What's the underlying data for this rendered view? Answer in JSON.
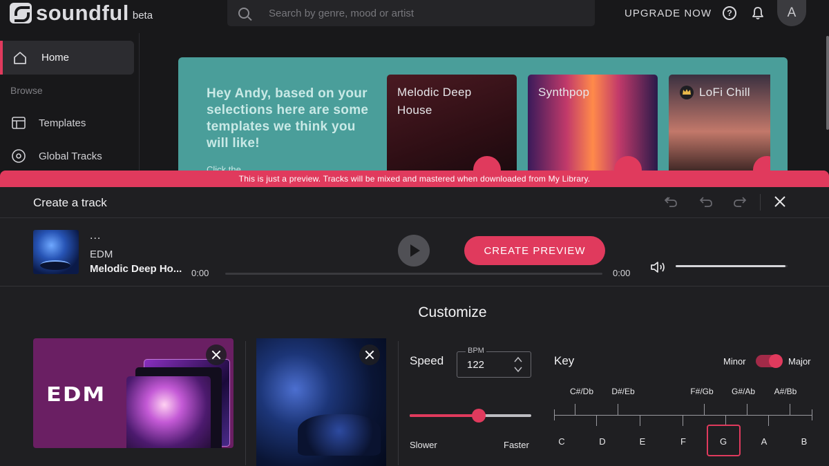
{
  "app": {
    "logo_text": "soundful",
    "logo_badge": "beta"
  },
  "header": {
    "search_placeholder": "Search by genre, mood or artist",
    "upgrade_label": "UPGRADE NOW",
    "help_glyph": "?",
    "avatar_initial": "A",
    "icons": [
      "search-icon",
      "help-icon",
      "bell-icon"
    ]
  },
  "sidebar": {
    "home_label": "Home",
    "browse_label": "Browse",
    "items": [
      {
        "label": "Templates",
        "icon": "templates-icon"
      },
      {
        "label": "Global Tracks",
        "icon": "global-tracks-icon"
      }
    ]
  },
  "banner": {
    "headline": "Hey Andy, based on your selections here are some templates we think you will like!",
    "sub_text": "Click the",
    "cards": [
      {
        "title": "Melodic Deep House",
        "premium": false
      },
      {
        "title": "Synthpop",
        "premium": false
      },
      {
        "title": "LoFi Chill",
        "premium": true
      }
    ]
  },
  "notice": "This is just a preview. Tracks will be mixed and mastered when downloaded from My Library.",
  "panel": {
    "title": "Create a track",
    "toolbar_icons": [
      "history-icon",
      "undo-icon",
      "redo-icon",
      "close-icon"
    ]
  },
  "player": {
    "track_title": "...",
    "genre": "EDM",
    "template_name": "Melodic Deep Ho...",
    "time_elapsed": "0:00",
    "time_total": "0:00",
    "progress": 0,
    "create_label": "CREATE PREVIEW",
    "volume": 0.98
  },
  "customize": {
    "heading": "Customize",
    "genre_card_label": "EDM",
    "speed": {
      "label": "Speed",
      "bpm_caption": "BPM",
      "bpm_value": "122",
      "slider_value": 0.57,
      "slower_label": "Slower",
      "faster_label": "Faster"
    },
    "key": {
      "label": "Key",
      "minor_label": "Minor",
      "major_label": "Major",
      "mode": "Major",
      "sharps": [
        "C#/Db",
        "D#/Eb",
        "F#/Gb",
        "G#/Ab",
        "A#/Bb"
      ],
      "notes": [
        "C",
        "D",
        "E",
        "F",
        "G",
        "A",
        "B"
      ],
      "selected_note": "G"
    }
  },
  "colors": {
    "accent": "#e03a5d",
    "banner": "#4a9e9a",
    "background": "#18181a",
    "panel": "#1f1f22"
  }
}
